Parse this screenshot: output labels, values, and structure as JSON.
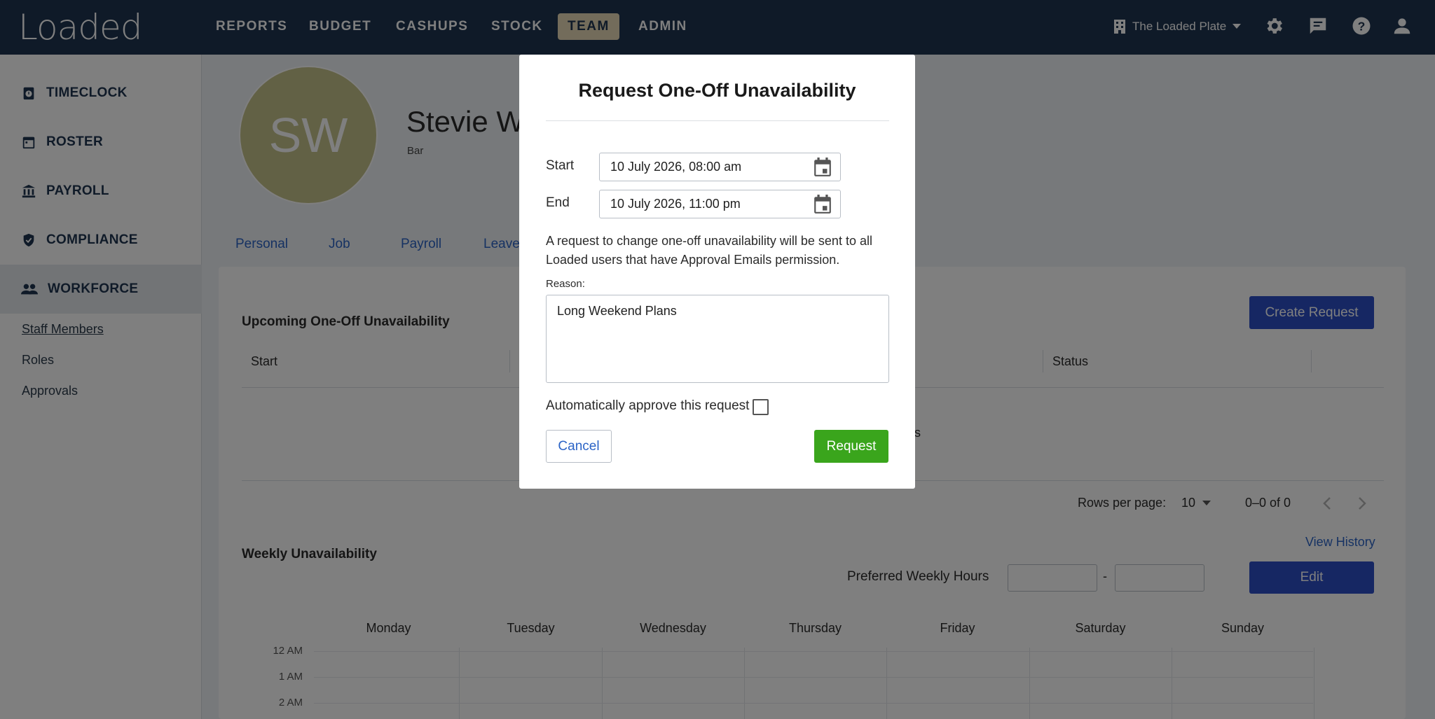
{
  "app": {
    "logo": "Loaded"
  },
  "nav": {
    "items": [
      {
        "label": "REPORTS",
        "active": false
      },
      {
        "label": "BUDGET",
        "active": false
      },
      {
        "label": "CASHUPS",
        "active": false
      },
      {
        "label": "STOCK",
        "active": false
      },
      {
        "label": "TEAM",
        "active": true
      },
      {
        "label": "ADMIN",
        "active": false
      }
    ],
    "venue": "The Loaded Plate",
    "icons": [
      "building-icon",
      "gear-icon",
      "chat-icon",
      "help-icon",
      "user-icon"
    ]
  },
  "sidebar": {
    "items": [
      {
        "label": "TIMECLOCK",
        "icon": "timeclock-icon"
      },
      {
        "label": "ROSTER",
        "icon": "calendar-icon"
      },
      {
        "label": "PAYROLL",
        "icon": "bank-icon"
      },
      {
        "label": "COMPLIANCE",
        "icon": "shield-icon"
      },
      {
        "label": "WORKFORCE",
        "icon": "people-icon",
        "active": true
      }
    ],
    "sub_items": [
      {
        "label": "Staff Members",
        "current": true
      },
      {
        "label": "Roles"
      },
      {
        "label": "Approvals"
      }
    ]
  },
  "profile": {
    "initials": "SW",
    "name": "Stevie Wo",
    "role": "Bar",
    "tabs": [
      "Personal",
      "Job",
      "Payroll",
      "Leave"
    ]
  },
  "one_off": {
    "title": "Upcoming One-Off Unavailability",
    "create_button": "Create Request",
    "columns": [
      "Start",
      "Status"
    ],
    "empty_fragment": "es",
    "rows_per_page_label": "Rows per page:",
    "rows_per_page_value": "10",
    "range": "0–0 of 0"
  },
  "weekly": {
    "title": "Weekly Unavailability",
    "view_history": "View History",
    "preferred_hours_label": "Preferred Weekly Hours",
    "hours_separator": "-",
    "edit_button": "Edit",
    "days": [
      "Monday",
      "Tuesday",
      "Wednesday",
      "Thursday",
      "Friday",
      "Saturday",
      "Sunday"
    ],
    "times": [
      "12 AM",
      "1 AM",
      "2 AM"
    ]
  },
  "modal": {
    "title": "Request One-Off Unavailability",
    "start_label": "Start",
    "start_value": "10 July 2026, 08:00 am",
    "end_label": "End",
    "end_value": "10 July 2026, 11:00 pm",
    "info": "A request to change one-off unavailability will be sent to all Loaded users that have Approval Emails permission.",
    "reason_label": "Reason:",
    "reason_value": "Long Weekend Plans",
    "auto_approve_label": "Automatically approve this request",
    "auto_approve_checked": false,
    "cancel": "Cancel",
    "request": "Request"
  },
  "colors": {
    "nav_bg": "#1f3550",
    "active_tab": "#e6d8b6",
    "primary": "#2c4fc7",
    "request": "#3aa51c",
    "link": "#2c64c6"
  }
}
